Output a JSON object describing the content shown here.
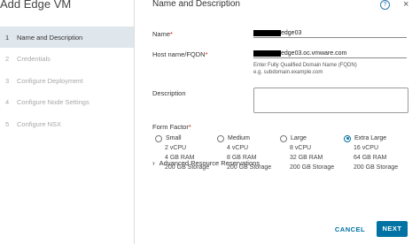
{
  "window": {
    "title": "Add Edge VM"
  },
  "steps": [
    {
      "num": "1",
      "label": "Name and Description",
      "active": true
    },
    {
      "num": "2",
      "label": "Credentials"
    },
    {
      "num": "3",
      "label": "Configure Deployment"
    },
    {
      "num": "4",
      "label": "Configure Node Settings"
    },
    {
      "num": "5",
      "label": "Configure NSX"
    }
  ],
  "header": {
    "title": "Name and Description",
    "help_glyph": "?",
    "close_glyph": "×"
  },
  "form": {
    "name": {
      "label": "Name",
      "required_mark": "*",
      "value_suffix": "edge03"
    },
    "hostname": {
      "label": "Host name/FQDN",
      "required_mark": "*",
      "value_suffix": "edge03.oc.vmware.com",
      "hint1": "Enter Fully Qualified Domain Name (FQDN)",
      "hint2": "e.g. subdomain.example.com"
    },
    "description": {
      "label": "Description",
      "value": ""
    },
    "form_factor": {
      "label": "Form Factor",
      "required_mark": "*",
      "options": [
        {
          "label": "Small",
          "cpu": "2 vCPU",
          "ram": "4 GB RAM",
          "storage": "200 GB Storage",
          "selected": false
        },
        {
          "label": "Medium",
          "cpu": "4 vCPU",
          "ram": "8 GB RAM",
          "storage": "200 GB Storage",
          "selected": false
        },
        {
          "label": "Large",
          "cpu": "8 vCPU",
          "ram": "32 GB RAM",
          "storage": "200 GB Storage",
          "selected": false
        },
        {
          "label": "Extra Large",
          "cpu": "16 vCPU",
          "ram": "64 GB RAM",
          "storage": "200 GB Storage",
          "selected": true
        }
      ]
    },
    "advanced": {
      "label": "Advanced Resource Reservations",
      "chevron": "›"
    }
  },
  "buttons": {
    "cancel": "CANCEL",
    "next": "NEXT"
  },
  "colors": {
    "accent": "#0072a3",
    "active_step_bg": "#dfe6ec",
    "required": "#c92100"
  }
}
